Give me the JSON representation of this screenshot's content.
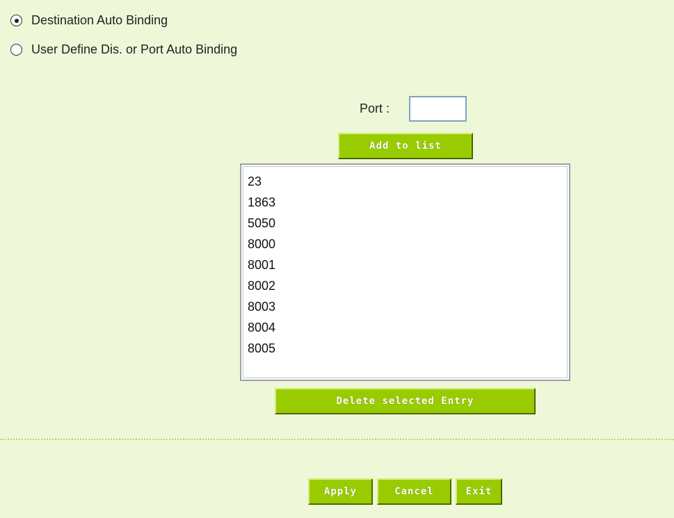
{
  "binding_mode": {
    "options": [
      {
        "label": "Destination Auto Binding",
        "selected": true
      },
      {
        "label": "User Define Dis. or Port Auto Binding",
        "selected": false
      }
    ]
  },
  "port": {
    "label": "Port :",
    "value": ""
  },
  "buttons": {
    "add_to_list": "Add to list",
    "delete_selected": "Delete selected Entry",
    "apply": "Apply",
    "cancel": "Cancel",
    "exit": "Exit"
  },
  "port_list": [
    "23",
    "1863",
    "5050",
    "8000",
    "8001",
    "8002",
    "8003",
    "8004",
    "8005"
  ],
  "colors": {
    "background": "#eef7d8",
    "button": "#99cc00",
    "divider": "#b5d866"
  }
}
